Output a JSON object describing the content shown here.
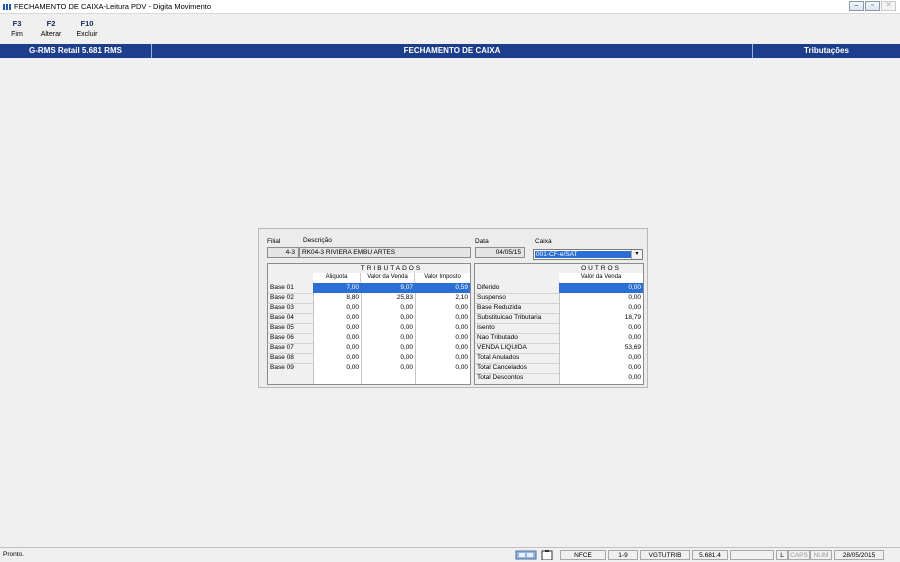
{
  "window": {
    "title": "FECHAMENTO DE CAIXA-Leitura PDV - Digita Movimento",
    "minimize": "–",
    "restore": "▫",
    "close": "✕"
  },
  "toolbar": [
    {
      "key": "F3",
      "label": "Fim"
    },
    {
      "key": "F2",
      "label": "Alterar"
    },
    {
      "key": "F10",
      "label": "Excluir"
    }
  ],
  "header": {
    "left": "G-RMS Retail 5.681 RMS",
    "center": "FECHAMENTO DE CAIXA",
    "right": "Tributações"
  },
  "form": {
    "filial_label": "Filial",
    "filial_value": "4-3",
    "descricao_label": "Descrição",
    "descricao_value": "RK04-3 RIVIERA EMBU ARTES",
    "data_label": "Data",
    "data_value": "04/05/15",
    "caixa_label": "Caixa",
    "caixa_value": "001-CF-e/SAT",
    "caixa_arrow": "▾"
  },
  "tributados": {
    "title": "TRIBUTADOS",
    "headers": [
      "Aliquota",
      "Valor da Venda",
      "Valor Imposto"
    ],
    "rows": [
      {
        "label": "Base 01",
        "aliquota": "7,00",
        "venda": "9,07",
        "imposto": "0,59"
      },
      {
        "label": "Base 02",
        "aliquota": "8,80",
        "venda": "25,83",
        "imposto": "2,10"
      },
      {
        "label": "Base 03",
        "aliquota": "0,00",
        "venda": "0,00",
        "imposto": "0,00"
      },
      {
        "label": "Base 04",
        "aliquota": "0,00",
        "venda": "0,00",
        "imposto": "0,00"
      },
      {
        "label": "Base 05",
        "aliquota": "0,00",
        "venda": "0,00",
        "imposto": "0,00"
      },
      {
        "label": "Base 06",
        "aliquota": "0,00",
        "venda": "0,00",
        "imposto": "0,00"
      },
      {
        "label": "Base 07",
        "aliquota": "0,00",
        "venda": "0,00",
        "imposto": "0,00"
      },
      {
        "label": "Base 08",
        "aliquota": "0,00",
        "venda": "0,00",
        "imposto": "0,00"
      },
      {
        "label": "Base 09",
        "aliquota": "0,00",
        "venda": "0,00",
        "imposto": "0,00"
      }
    ]
  },
  "outros": {
    "title": "OUTROS",
    "header": "Valor da Venda",
    "rows": [
      {
        "label": "Diferido",
        "value": "0,00"
      },
      {
        "label": "Suspenso",
        "value": "0,00"
      },
      {
        "label": "Base Reduzida",
        "value": "0,00"
      },
      {
        "label": "Substituicao Tributaria",
        "value": "18,79"
      },
      {
        "label": "Isento",
        "value": "0,00"
      },
      {
        "label": "Nao Tributado",
        "value": "0,00"
      },
      {
        "label": "VENDA LIQUIDA",
        "value": "53,69"
      },
      {
        "label": "Total Anulados",
        "value": "0,00"
      },
      {
        "label": "Total Cancelados",
        "value": "0,00"
      },
      {
        "label": "Total Descontos",
        "value": "0,00"
      }
    ]
  },
  "status": {
    "text": "Pronto.",
    "cells": [
      "NFCE",
      "1-9",
      "VGTUTRIB",
      "5.681.4",
      "",
      "L",
      "CAPS",
      "NUM",
      "28/05/2015"
    ]
  }
}
